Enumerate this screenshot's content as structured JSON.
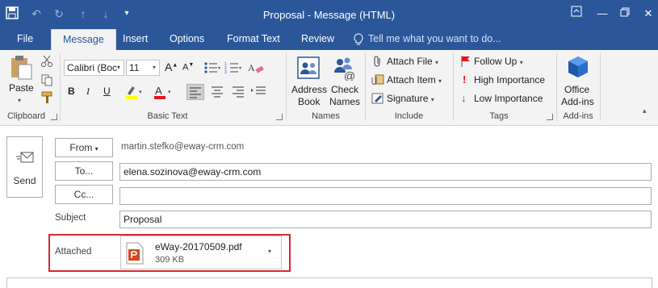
{
  "window": {
    "title": "Proposal - Message (HTML)"
  },
  "tabs": [
    {
      "label": "File"
    },
    {
      "label": "Message"
    },
    {
      "label": "Insert"
    },
    {
      "label": "Options"
    },
    {
      "label": "Format Text"
    },
    {
      "label": "Review"
    },
    {
      "label": "Tell me what you want to do..."
    }
  ],
  "ribbon": {
    "clipboard": {
      "paste": "Paste",
      "label": "Clipboard"
    },
    "basic_text": {
      "font": "Calibri (Boc",
      "size": "11",
      "label": "Basic Text"
    },
    "names": {
      "address_book": [
        "Address",
        "Book"
      ],
      "check_names": [
        "Check",
        "Names"
      ],
      "label": "Names"
    },
    "include": {
      "attach_file": "Attach File",
      "attach_item": "Attach Item",
      "signature": "Signature",
      "label": "Include"
    },
    "tags": {
      "follow_up": "Follow Up",
      "high": "High Importance",
      "low": "Low Importance",
      "label": "Tags"
    },
    "addins": {
      "office": [
        "Office",
        "Add-ins"
      ],
      "label": "Add-ins"
    }
  },
  "compose": {
    "send": "Send",
    "from_label": "From",
    "from_value": "martin.stefko@eway-crm.com",
    "to_label": "To...",
    "to_value": "elena.sozinova@eway-crm.com",
    "cc_label": "Cc...",
    "cc_value": "",
    "subject_label": "Subject",
    "subject_value": "Proposal",
    "attached_label": "Attached",
    "attachment": {
      "name": "eWay-20170509.pdf",
      "size": "309 KB"
    }
  },
  "colors": {
    "brand": "#2b579a",
    "highlight_box": "#d9282f",
    "pdf": "#d24726"
  }
}
